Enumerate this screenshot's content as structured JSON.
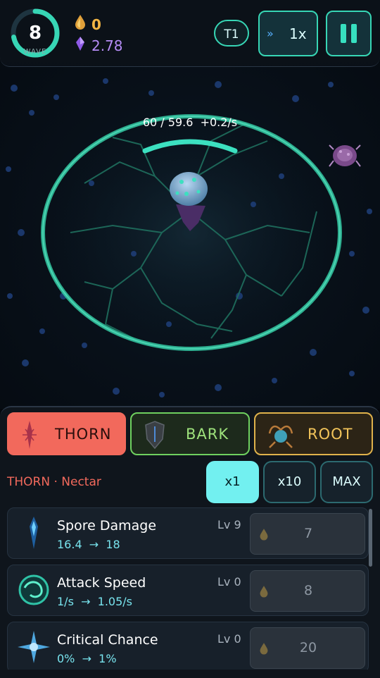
{
  "hud": {
    "wave_number": "8",
    "wave_label": "WAVE",
    "wave_progress": 0.72,
    "nectar_value": "0",
    "essence_value": "2.78",
    "tier_label": "T1",
    "speed_label": "1x"
  },
  "arena": {
    "hp_text": "60 / 59.6",
    "regen_text": "+0.2/s",
    "hp_fraction": 1.0
  },
  "tabs": {
    "thorn": "THORN",
    "bark": "BARK",
    "root": "ROOT"
  },
  "section": {
    "subtitle": "THORN · Nectar"
  },
  "multipliers": {
    "x1": "x1",
    "x10": "x10",
    "max": "MAX"
  },
  "upgrades": [
    {
      "name": "Spore Damage",
      "level": "Lv 9",
      "from": "16.4",
      "to": "18",
      "cost": "7",
      "icon": "spore-crystal-icon"
    },
    {
      "name": "Attack Speed",
      "level": "Lv 0",
      "from": "1/s",
      "to": "1.05/s",
      "cost": "8",
      "icon": "swirl-orb-icon"
    },
    {
      "name": "Critical Chance",
      "level": "Lv 0",
      "from": "0%",
      "to": "1%",
      "cost": "20",
      "icon": "star-burst-icon"
    }
  ],
  "colors": {
    "accent_teal": "#37d6b5",
    "thorn_red": "#f2695c",
    "bark_green": "#6fd05f",
    "root_gold": "#e0b24b",
    "stat_cyan": "#78e4ee",
    "nectar_gold": "#f2b544",
    "essence_purple": "#b58cf5"
  }
}
